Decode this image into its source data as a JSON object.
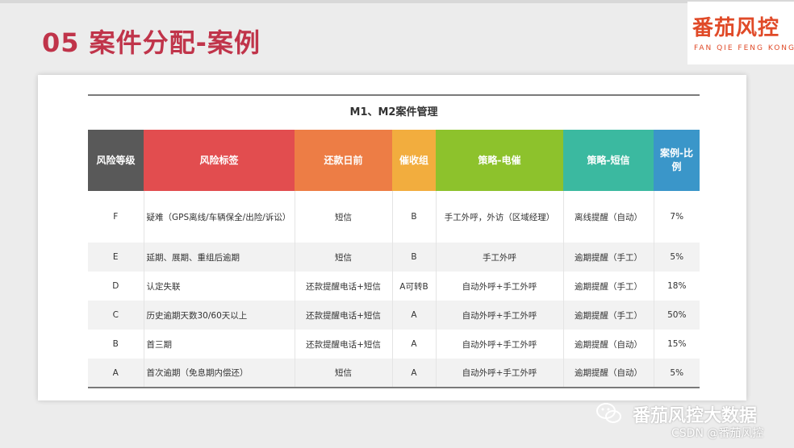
{
  "slide": {
    "title": "05 案件分配-案例"
  },
  "logo": {
    "name": "番茄风控",
    "subtitle": "FAN QIE FENG KONG"
  },
  "table": {
    "caption": "M1、M2案件管理",
    "headers": [
      {
        "label": "风险等级",
        "color": "#595959"
      },
      {
        "label": "风险标签",
        "color": "#e24d4f"
      },
      {
        "label": "还款日前",
        "color": "#ed7d45"
      },
      {
        "label": "催收组",
        "color": "#f2ad3e"
      },
      {
        "label": "策略-电催",
        "color": "#8dc22c"
      },
      {
        "label": "策略-短信",
        "color": "#3bb9a0"
      },
      {
        "label": "案例-比例",
        "color": "#3a96c9"
      }
    ],
    "rows": [
      [
        "F",
        "疑难（GPS离线/车辆保全/出险/诉讼）",
        "短信",
        "B",
        "手工外呼，外访（区域经理）",
        "离线提醒（自动）",
        "7%"
      ],
      [
        "E",
        "延期、展期、重组后逾期",
        "短信",
        "B",
        "手工外呼",
        "逾期提醒（手工）",
        "5%"
      ],
      [
        "D",
        "认定失联",
        "还款提醒电话+短信",
        "A可转B",
        "自动外呼+手工外呼",
        "逾期提醒（手工）",
        "18%"
      ],
      [
        "C",
        "历史逾期天数30/60天以上",
        "还款提醒电话+短信",
        "A",
        "自动外呼+手工外呼",
        "逾期提醒（手工）",
        "50%"
      ],
      [
        "B",
        "首三期",
        "还款提醒电话+短信",
        "A",
        "自动外呼+手工外呼",
        "逾期提醒（自动）",
        "15%"
      ],
      [
        "A",
        "首次逾期（免息期内偿还）",
        "短信",
        "A",
        "自动外呼+手工外呼",
        "逾期提醒（自动）",
        "5%"
      ]
    ]
  },
  "watermark": {
    "channel": "番茄风控大数据",
    "csdn": "CSDN @番茄风控"
  }
}
